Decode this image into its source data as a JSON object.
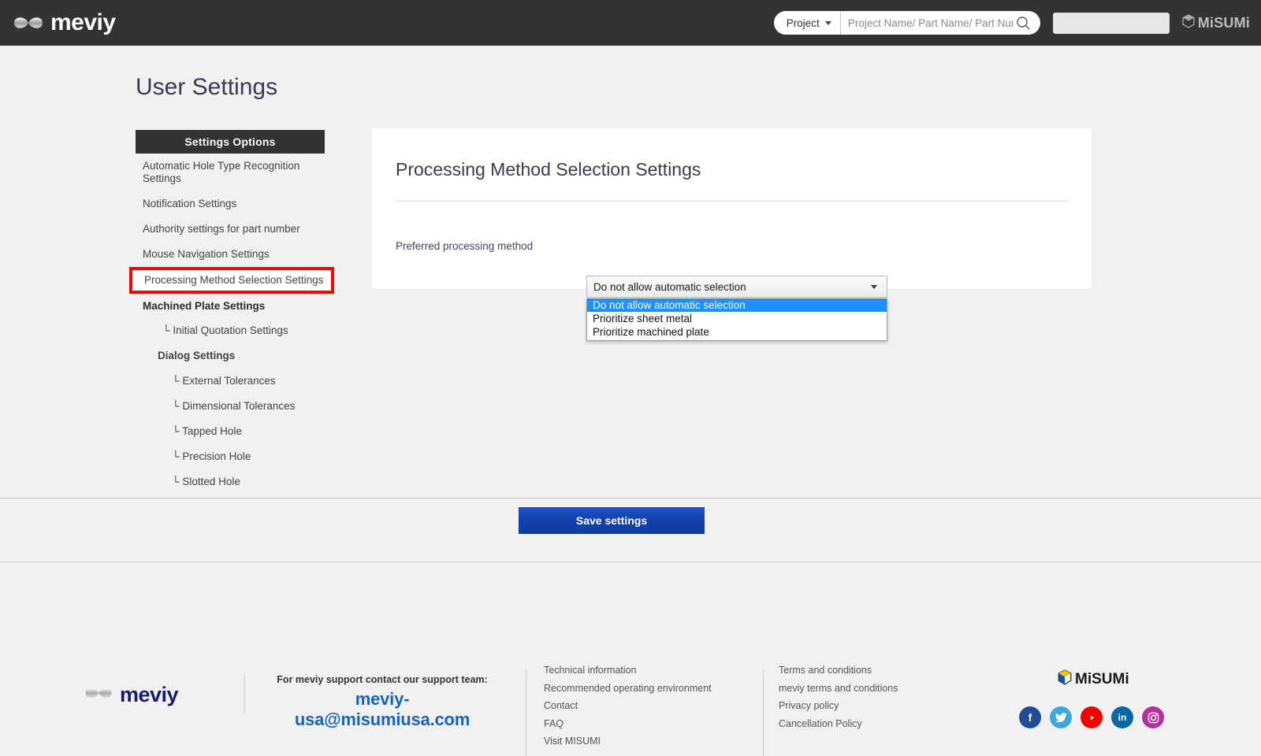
{
  "header": {
    "brand": "meviy",
    "brand_icon": "infinity-logo-icon",
    "search": {
      "scope_label": "Project",
      "scope_caret_icon": "chevron-down-icon",
      "placeholder": "Project Name/ Part Name/ Part Number",
      "value": "",
      "search_icon": "search-icon"
    },
    "misumi_label": "MiSUMi",
    "misumi_icon": "misumi-cube-icon"
  },
  "page": {
    "title": "User Settings"
  },
  "sidebar": {
    "heading": "Settings Options",
    "items": [
      {
        "label": "Automatic Hole Type Recognition Settings",
        "style": "plain"
      },
      {
        "label": "Notification Settings",
        "style": "plain"
      },
      {
        "label": "Authority settings for part number",
        "style": "plain"
      },
      {
        "label": "Mouse Navigation Settings",
        "style": "plain"
      },
      {
        "label": "Processing Method Selection Settings",
        "style": "highlight"
      },
      {
        "label": "Machined Plate Settings",
        "style": "bold"
      },
      {
        "label": "└ Initial Quotation Settings",
        "style": "indent1"
      },
      {
        "label": "Dialog Settings",
        "style": "indent2"
      },
      {
        "label": "└ External Tolerances",
        "style": "indent3"
      },
      {
        "label": "└ Dimensional Tolerances",
        "style": "indent3"
      },
      {
        "label": "└ Tapped Hole",
        "style": "indent3"
      },
      {
        "label": "└ Precision Hole",
        "style": "indent3"
      },
      {
        "label": "└ Slotted Hole",
        "style": "indent3"
      }
    ],
    "highlight_color": "#ff0000"
  },
  "main": {
    "panel_title": "Processing Method Selection Settings",
    "field_label": "Preferred processing method",
    "select": {
      "value": "Do not allow automatic selection",
      "arrow_icon": "chevron-down-icon",
      "expanded": true,
      "options": [
        "Do not allow automatic selection",
        "Prioritize sheet metal",
        "Prioritize machined plate"
      ],
      "selected_index": 0,
      "highlight_color": "#1e90ff"
    }
  },
  "actions": {
    "save_label": "Save settings",
    "save_color": "#1342ad"
  },
  "footer": {
    "brand": "meviy",
    "brand_icon": "infinity-logo-icon",
    "support_line": "For meviy support contact our support team:",
    "support_email": "meviy-usa@misumiusa.com",
    "columns": [
      {
        "links": [
          "Technical information",
          "Recommended operating environment",
          "Contact",
          "FAQ",
          "Visit MISUMI"
        ]
      },
      {
        "links": [
          "Terms and conditions",
          "meviy terms and conditions",
          "Privacy policy",
          "Cancellation Policy"
        ]
      }
    ],
    "misumi_label": "MiSUMi",
    "misumi_icon": "misumi-cube-icon",
    "socials": [
      {
        "name": "facebook-icon",
        "glyph": "f",
        "color": "#1f4b99"
      },
      {
        "name": "twitter-icon",
        "glyph": "ᵗ",
        "color": "#3ba9e0"
      },
      {
        "name": "youtube-icon",
        "glyph": "▶",
        "color": "#f40000"
      },
      {
        "name": "linkedin-icon",
        "glyph": "in",
        "color": "#0a66a8"
      },
      {
        "name": "instagram-icon",
        "glyph": "▣",
        "color": "#b5309a"
      }
    ]
  }
}
